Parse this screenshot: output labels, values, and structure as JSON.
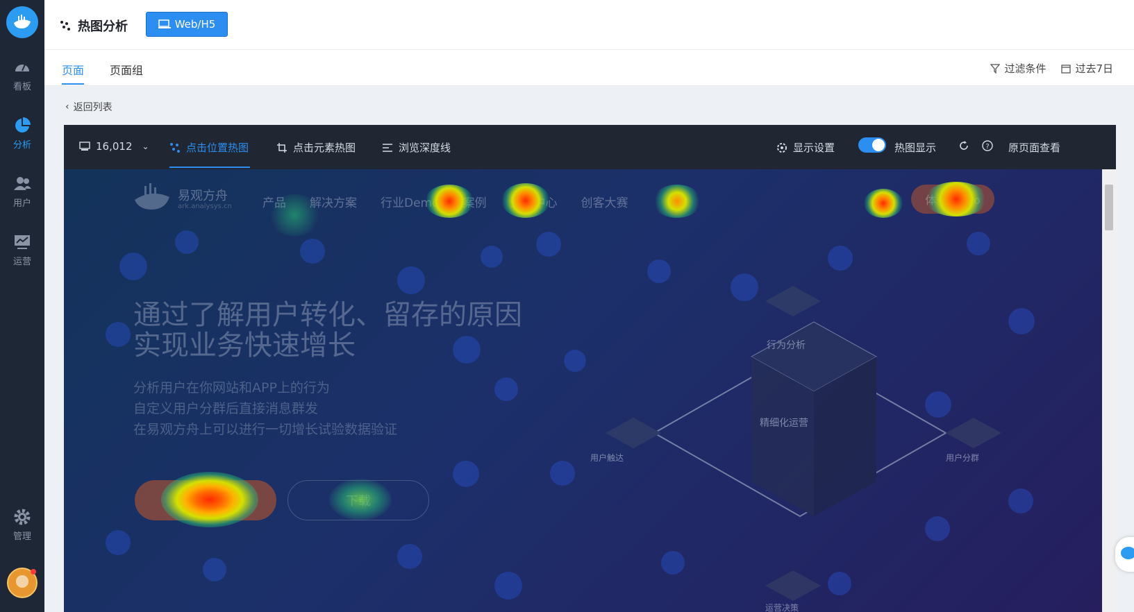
{
  "sidebar": {
    "items": [
      {
        "label": "看板",
        "icon": "dashboard-icon"
      },
      {
        "label": "分析",
        "icon": "pie-chart-icon",
        "active": true
      },
      {
        "label": "用户",
        "icon": "users-icon"
      },
      {
        "label": "运营",
        "icon": "monitor-icon"
      },
      {
        "label": "管理",
        "icon": "gear-icon"
      }
    ]
  },
  "header": {
    "title": "热图分析",
    "platform_button": "Web/H5"
  },
  "tabs": [
    {
      "label": "页面",
      "active": true
    },
    {
      "label": "页面组",
      "active": false
    }
  ],
  "tools": {
    "filter": "过滤条件",
    "date_range": "过去7日"
  },
  "back_link": "返回列表",
  "heatmap_toolbar": {
    "count": "16,012",
    "modes": [
      {
        "label": "点击位置热图",
        "active": true
      },
      {
        "label": "点击元素热图",
        "active": false
      },
      {
        "label": "浏览深度线",
        "active": false
      }
    ],
    "display_settings": "显示设置",
    "heatmap_toggle_label": "热图显示",
    "heatmap_toggle_on": true,
    "view_original": "原页面查看"
  },
  "page_preview": {
    "brand": "易观方舟",
    "brand_site": "ark.analysys.cn",
    "nav": [
      "产品",
      "解决方案",
      "行业Demo",
      "案例",
      "资源中心",
      "创客大赛"
    ],
    "demo_button": "体验Demo",
    "hero_title_line1": "通过了解用户转化、留存的原因",
    "hero_title_line2": "实现业务快速增长",
    "hero_sub": [
      "分析用户在你网站和APP上的行为",
      "自定义用户分群后直接消息群发",
      "在易观方舟上可以进行一切增长试验数据验证"
    ],
    "try_button": "体验Demo",
    "download_button": "下载",
    "iso_labels": [
      "行为分析",
      "精细化运营",
      "用户触达",
      "用户分群",
      "运营决策"
    ]
  },
  "colors": {
    "accent": "#2b8ef0",
    "rail_bg": "#1e2735",
    "toolbar_bg": "#202733"
  }
}
